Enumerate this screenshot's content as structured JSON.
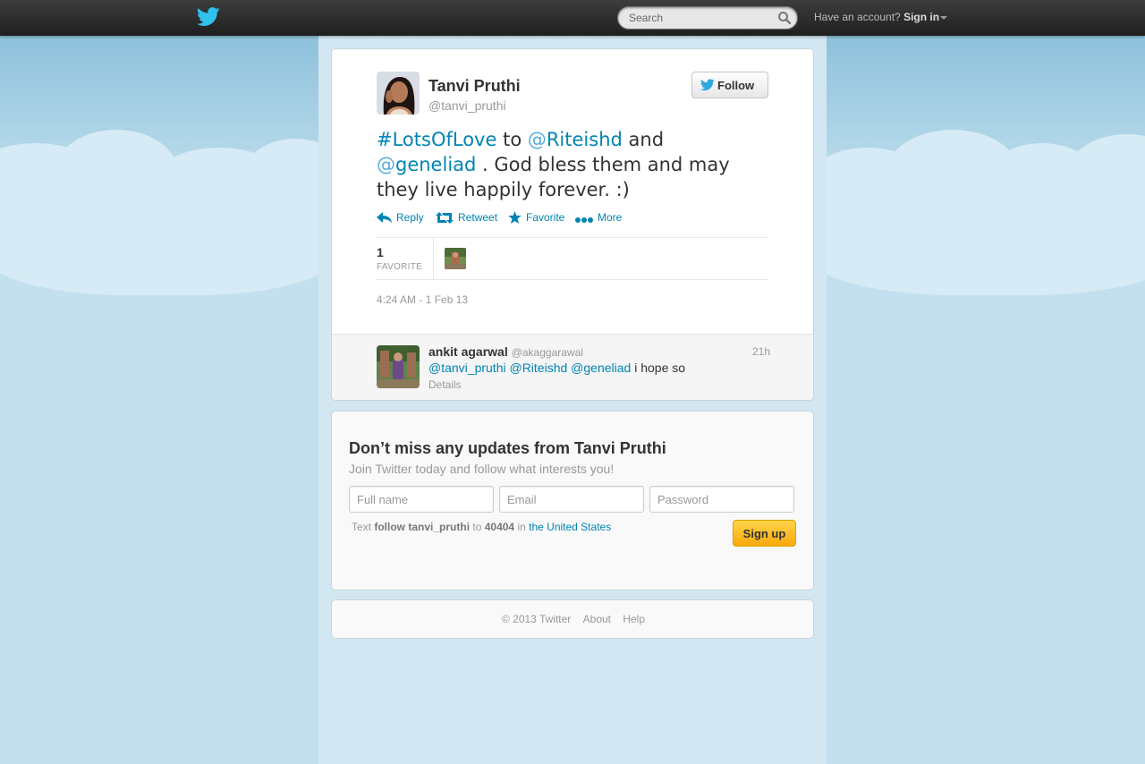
{
  "topbar": {
    "search_placeholder": "Search",
    "account_prompt": "Have an account?",
    "signin_label": "Sign in"
  },
  "tweet": {
    "author_name": "Tanvi Pruthi",
    "author_handle": "@tanvi_pruthi",
    "follow_label": "Follow",
    "text": {
      "hashtag": "#LotsOfLove",
      "to": " to ",
      "mention1_at": "@",
      "mention1": "Riteishd",
      "and": " and",
      "mention2_at": "@",
      "mention2": "geneliad",
      "rest": " . God bless them and may they live happily forever. :)"
    },
    "actions": {
      "reply": "Reply",
      "retweet": "Retweet",
      "favorite": "Favorite",
      "more": "More"
    },
    "stats": {
      "favorite_count": "1",
      "favorite_label": "FAVORITE"
    },
    "timestamp": "4:24 AM - 1 Feb 13"
  },
  "reply": {
    "name": "ankit agarwal",
    "handle": "@akaggarawal",
    "time": "21h",
    "mention1": "@tanvi_pruthi",
    "mention2": "@Riteishd",
    "mention3": "@geneliad",
    "text": " i hope so",
    "details": "Details"
  },
  "signup": {
    "title": "Don’t miss any updates from Tanvi Pruthi",
    "subtitle": "Join Twitter today and follow what interests you!",
    "fullname_placeholder": "Full name",
    "email_placeholder": "Email",
    "password_placeholder": "Password",
    "sms_text": "Text",
    "sms_command": "follow tanvi_pruthi",
    "sms_to": "to",
    "sms_number": "40404",
    "sms_in": "in",
    "sms_country": "the United States",
    "button": "Sign up"
  },
  "footer": {
    "copyright": "© 2013 Twitter",
    "about": "About",
    "help": "Help"
  },
  "colors": {
    "link": "#0084b4",
    "mention_at": "#55acdd",
    "topbar": "#2b2b2b",
    "background": "#c0deed",
    "signup_button": "#f9a90c"
  },
  "icons": [
    "twitter-bird-icon",
    "search-icon",
    "reply-icon",
    "retweet-icon",
    "star-icon",
    "more-dots-icon"
  ]
}
